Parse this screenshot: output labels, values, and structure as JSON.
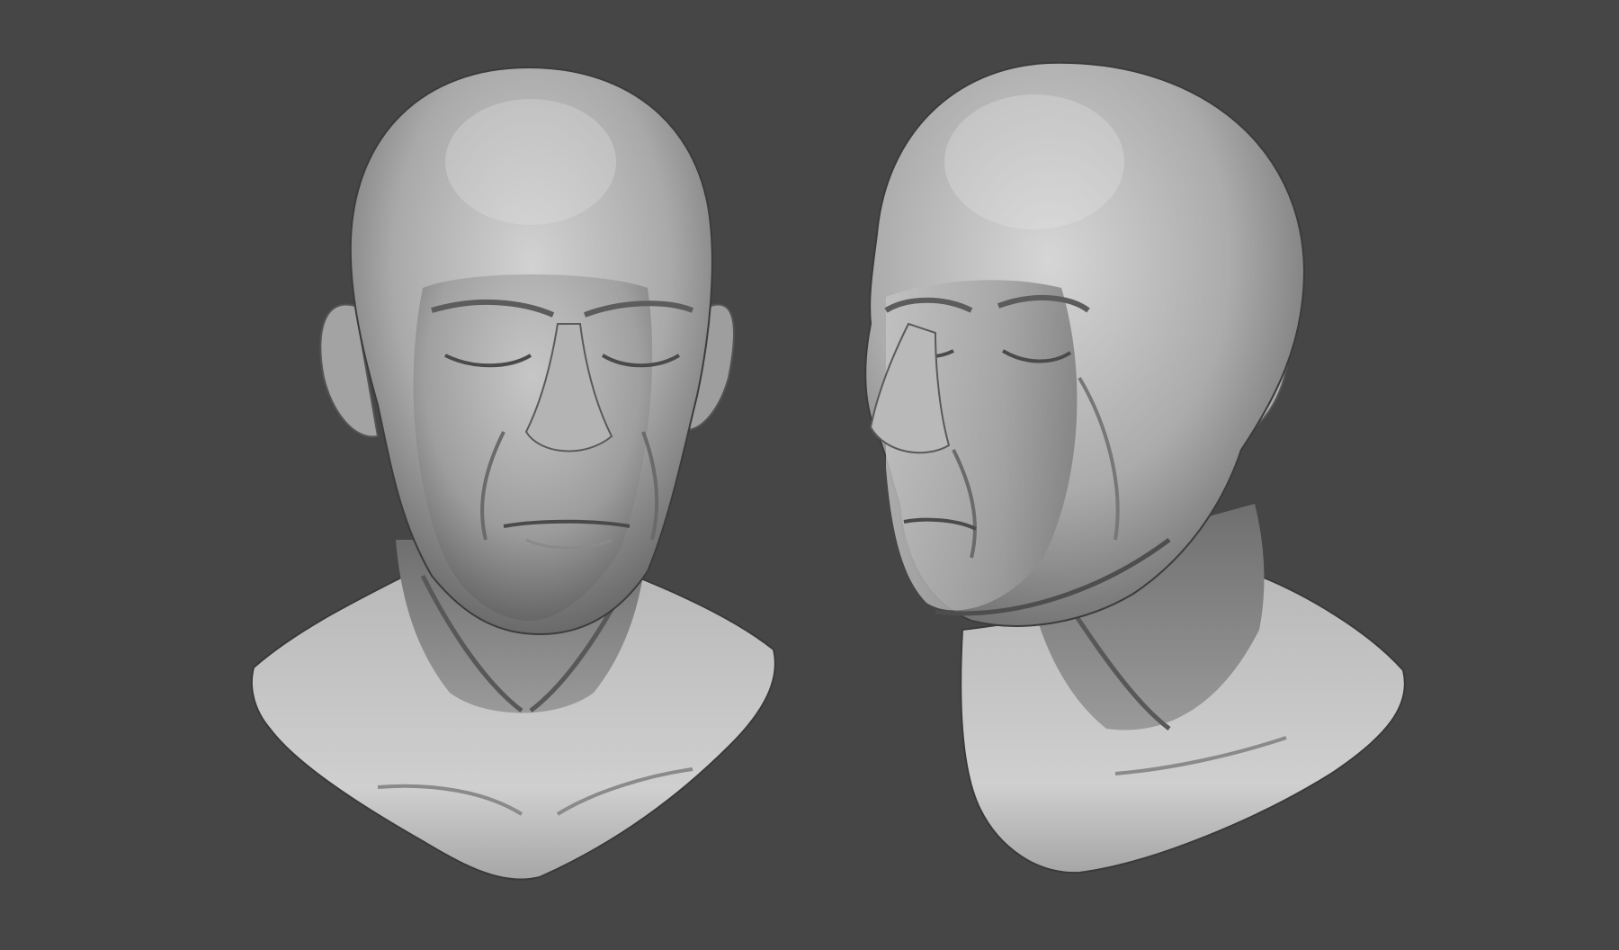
{
  "scene": {
    "background_color": "#464646",
    "material_color": "#bdbdbd",
    "models": [
      {
        "name": "head-sculpt-front",
        "view": "front"
      },
      {
        "name": "head-sculpt-three-quarter",
        "view": "three-quarter"
      }
    ]
  }
}
